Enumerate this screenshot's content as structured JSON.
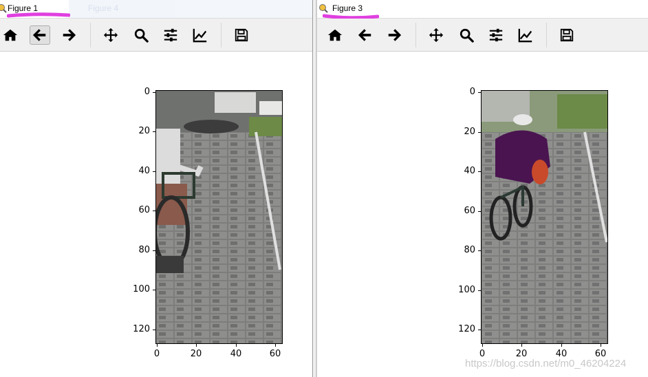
{
  "windows": [
    {
      "title": "Figure 1",
      "behind_title": "Figure 4",
      "highlight_color": "#e040e0",
      "pressed_tool": "back",
      "axes": {
        "y_ticks": [
          "0",
          "20",
          "40",
          "60",
          "80",
          "100",
          "120"
        ],
        "x_ticks": [
          "0",
          "20",
          "40",
          "60"
        ]
      }
    },
    {
      "title": "Figure 3",
      "highlight_color": "#e040e0",
      "pressed_tool": "",
      "axes": {
        "y_ticks": [
          "0",
          "20",
          "40",
          "60",
          "80",
          "100",
          "120"
        ],
        "x_ticks": [
          "0",
          "20",
          "40",
          "60"
        ]
      }
    }
  ],
  "toolbar_icons": [
    "home-icon",
    "back-arrow-icon",
    "forward-arrow-icon",
    "pan-icon",
    "zoom-icon",
    "configure-subplots-icon",
    "edit-axis-icon",
    "save-icon"
  ],
  "watermark": "https://blog.csdn.net/m0_46204224"
}
